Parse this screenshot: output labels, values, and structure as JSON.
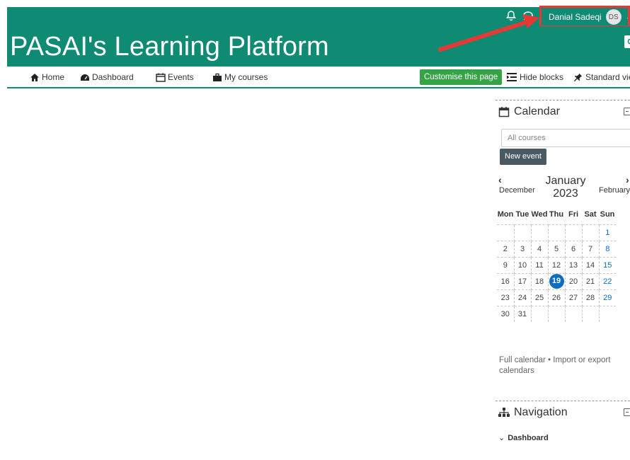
{
  "header": {
    "user_name": "Danial Sadeqi",
    "avatar_initials": "DS",
    "site_title": "PASAI's Learning Platform"
  },
  "nav": {
    "items": [
      {
        "label": "Home",
        "icon": "home-icon"
      },
      {
        "label": "Dashboard",
        "icon": "dashboard-icon"
      },
      {
        "label": "Events",
        "icon": "calendar-icon"
      },
      {
        "label": "My courses",
        "icon": "briefcase-icon"
      }
    ],
    "customise_label": "Customise this page",
    "hide_blocks_label": "Hide blocks",
    "standard_view_label": "Standard view"
  },
  "calendar_block": {
    "title": "Calendar",
    "course_filter": "All courses",
    "new_event_label": "New event",
    "prev_month": "December",
    "next_month": "February",
    "month": "January",
    "year": "2023",
    "weekdays": [
      "Mon",
      "Tue",
      "Wed",
      "Thu",
      "Fri",
      "Sat",
      "Sun"
    ],
    "weeks": [
      [
        "",
        "",
        "",
        "",
        "",
        "",
        "1"
      ],
      [
        "2",
        "3",
        "4",
        "5",
        "6",
        "7",
        "8"
      ],
      [
        "9",
        "10",
        "11",
        "12",
        "13",
        "14",
        "15"
      ],
      [
        "16",
        "17",
        "18",
        "19",
        "20",
        "21",
        "22"
      ],
      [
        "23",
        "24",
        "25",
        "26",
        "27",
        "28",
        "29"
      ],
      [
        "30",
        "31",
        "",
        "",
        "",
        "",
        ""
      ]
    ],
    "today": "19",
    "full_calendar_label": "Full calendar",
    "separator": " • ",
    "import_export_label": "Import or export calendars"
  },
  "navigation_block": {
    "title": "Navigation",
    "first_item": "Dashboard"
  },
  "colors": {
    "brand": "#0f8a73",
    "customise": "#35a346",
    "today": "#0f6cbf",
    "highlight": "#e53935"
  }
}
